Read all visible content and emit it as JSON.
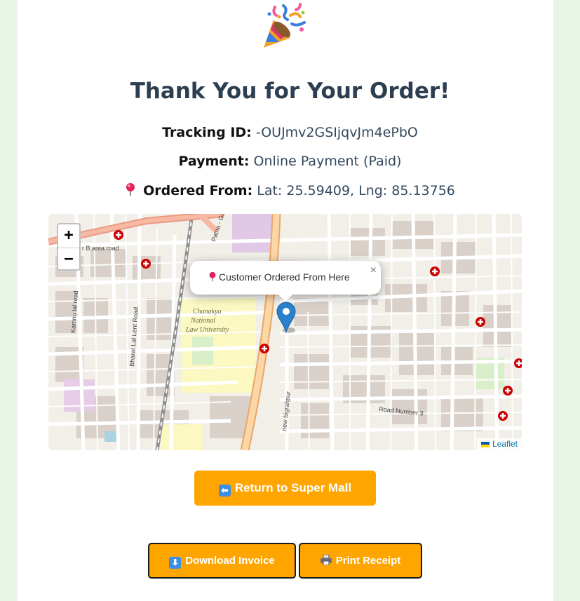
{
  "page": {
    "title": "Thank You for Your Order!",
    "tracking_label": "Tracking ID:",
    "tracking_value": "-OUJmv2GSIjqvJm4ePbO",
    "payment_label": "Payment:",
    "payment_value": "Online Payment (Paid)",
    "origin_label": "Ordered From:",
    "origin_value": "Lat: 25.59409, Lng: 85.13756"
  },
  "map": {
    "zoom_in": "+",
    "zoom_out": "−",
    "popup_text": "Customer Ordered From Here",
    "popup_close": "×",
    "attribution": "Leaflet",
    "labels": {
      "b_area_road": "r B area road",
      "patna_gaya": "Patna - Gaya",
      "kamnu_lal_road": "Kamnu lal road",
      "bharat_lal_lent_road": "Bharat Lal Lent Road",
      "university_1": "Chanakya",
      "university_2": "National",
      "university_3": "Law University",
      "new_bigrahpur": "new bigrahpur",
      "road_number_3": "Road Number 3"
    }
  },
  "actions": {
    "return_label": "Return to Super Mall",
    "return_icon": "⬅",
    "download_label": "Download Invoice",
    "download_icon": "⬇",
    "print_label": "Print Receipt",
    "print_icon": "printer-icon"
  },
  "colors": {
    "accent": "#ffa500",
    "heading": "#2c3e50",
    "page_bg": "#e7f4e6",
    "marker": "#2a81cb",
    "poi": "#cc0000"
  }
}
